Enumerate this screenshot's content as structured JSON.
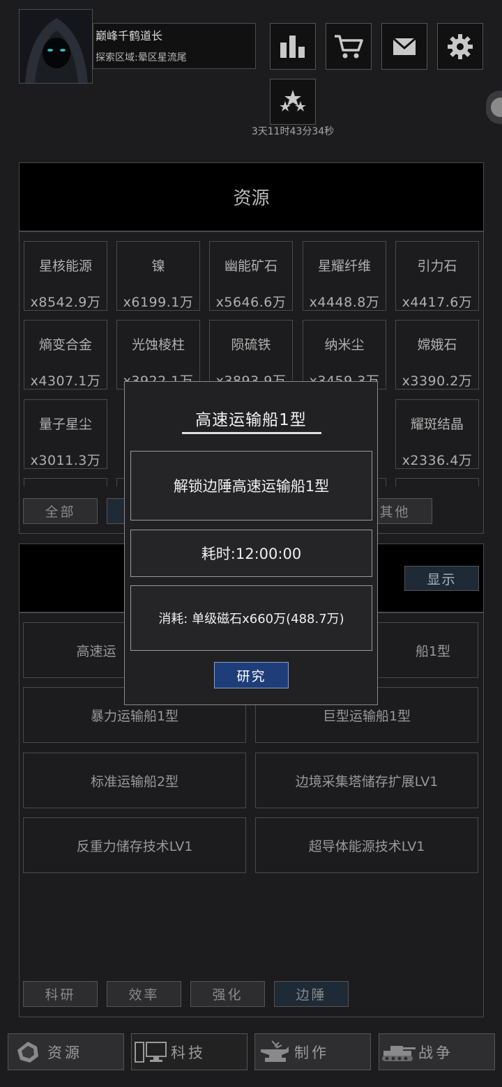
{
  "player": {
    "name": "巅峰千鹤道长",
    "area": "探索区域:晕区星流尾"
  },
  "header_icons": [
    "stats-icon",
    "cart-icon",
    "mail-icon",
    "settings-icon",
    "rank-icon"
  ],
  "timer": "3天11时43分34秒",
  "resources": {
    "title": "资源",
    "items": [
      {
        "name": "星核能源",
        "qty": "x8542.9万"
      },
      {
        "name": "镍",
        "qty": "x6199.1万"
      },
      {
        "name": "幽能矿石",
        "qty": "x5646.6万"
      },
      {
        "name": "星耀纤维",
        "qty": "x4448.8万"
      },
      {
        "name": "引力石",
        "qty": "x4417.6万"
      },
      {
        "name": "熵变合金",
        "qty": "x4307.1万"
      },
      {
        "name": "光蚀棱柱",
        "qty": "x3922.1万"
      },
      {
        "name": "陨硫铁",
        "qty": "x3893.9万"
      },
      {
        "name": "纳米尘",
        "qty": "x3459.3万"
      },
      {
        "name": "嫦娥石",
        "qty": "x3390.2万"
      },
      {
        "name": "量子星尘",
        "qty": "x3011.3万"
      },
      {
        "name": "耀斑结晶",
        "qty": "x2336.4万"
      }
    ],
    "filters": [
      "全部",
      "其他"
    ]
  },
  "tech": {
    "show_label": "显示",
    "items": [
      {
        "left": "高速运",
        "right": "船1型"
      },
      {
        "left": "暴力运输船1型",
        "right": "巨型运输船1型"
      },
      {
        "left": "标准运输船2型",
        "right": "边境采集塔储存扩展LV1"
      },
      {
        "left": "反重力储存技术LV1",
        "right": "超导体能源技术LV1"
      }
    ],
    "categories": [
      "科研",
      "效率",
      "强化",
      "边陲"
    ]
  },
  "nav": {
    "items": [
      "资源",
      "科技",
      "制作",
      "战争"
    ]
  },
  "modal": {
    "title": "高速运输船1型",
    "description": "解锁边陲高速运输船1型",
    "duration": "耗时:12:00:00",
    "cost": "消耗: 单级磁石x660万(488.7万)",
    "action": "研究"
  },
  "colors": {
    "background": "#1c1c1e",
    "research_button": "#1f3d78",
    "active_tab": "#1e2a36"
  }
}
